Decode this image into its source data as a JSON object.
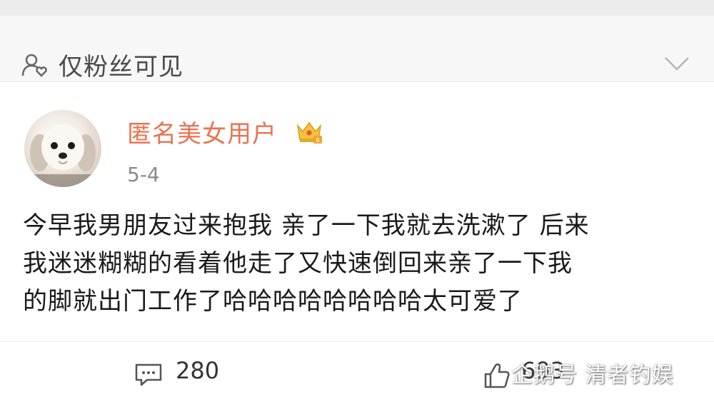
{
  "visibility": {
    "label": "仅粉丝可见",
    "icon": "fans-only-icon"
  },
  "post": {
    "username": "匿名美女用户",
    "date": "5-4",
    "content_lines": [
      "今早我男朋友过来抱我 亲了一下我就去洗漱了  后来",
      "我迷迷糊糊的看着他走了又快速倒回来亲了一下我",
      "的脚就出门工作了哈哈哈哈哈哈哈哈太可爱了"
    ]
  },
  "actions": {
    "comment_count": "280",
    "like_count": "693"
  },
  "watermark": "企鹅号 清者钓娱",
  "colors": {
    "username": "#eb7350",
    "text": "#1a1a1a",
    "muted": "#8a8a8a"
  }
}
